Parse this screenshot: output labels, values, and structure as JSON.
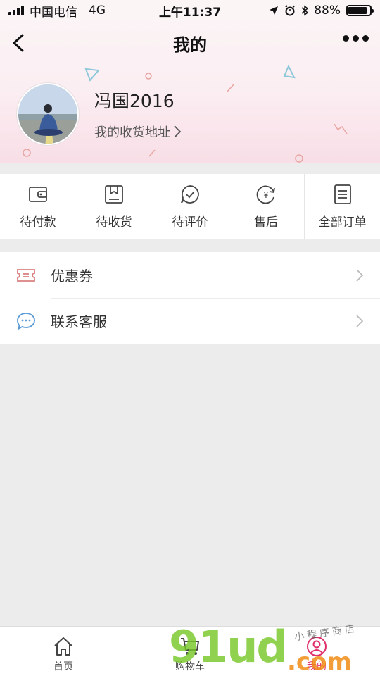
{
  "status_bar": {
    "carrier": "中国电信",
    "network": "4G",
    "time": "上午11:37",
    "battery": "88%",
    "battery_level": 0.88
  },
  "header": {
    "title": "我的"
  },
  "profile": {
    "name": "冯国2016",
    "address_link": "我的收货地址"
  },
  "orders": {
    "items": [
      {
        "label": "待付款",
        "icon": "wallet-icon"
      },
      {
        "label": "待收货",
        "icon": "package-icon"
      },
      {
        "label": "待评价",
        "icon": "review-icon"
      },
      {
        "label": "售后",
        "icon": "after-sales-icon"
      },
      {
        "label": "全部订单",
        "icon": "order-list-icon"
      }
    ]
  },
  "menu": {
    "items": [
      {
        "label": "优惠券",
        "icon": "coupon-icon",
        "color": "#d98080"
      },
      {
        "label": "联系客服",
        "icon": "chat-icon",
        "color": "#5b9ad5"
      }
    ]
  },
  "tabbar": {
    "tabs": [
      {
        "label": "首页",
        "icon": "home-icon"
      },
      {
        "label": "购物车",
        "icon": "cart-icon"
      },
      {
        "label": "我的",
        "icon": "profile-icon",
        "active": true
      }
    ],
    "active_color": "#e0306a"
  },
  "watermark": {
    "main": "91ud",
    "domain": ".com",
    "tagline": "小程序商店"
  }
}
